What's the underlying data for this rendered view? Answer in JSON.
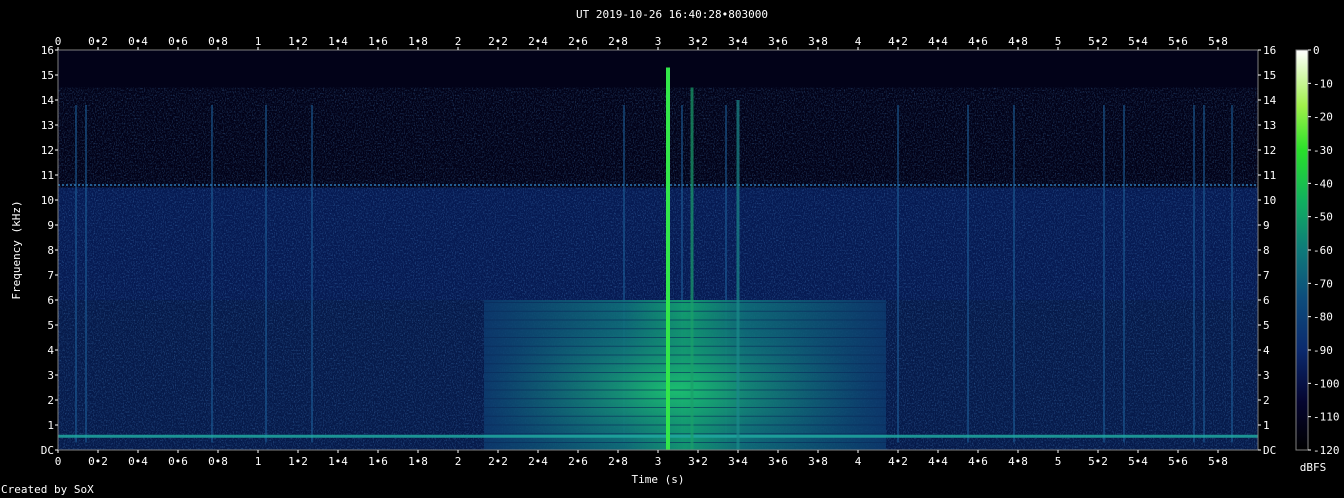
{
  "chart_data": {
    "type": "heatmap",
    "title": "UT 2019-10-26 16:40:28•803000",
    "xlabel": "Time (s)",
    "ylabel": "Frequency (kHz)",
    "xlim": [
      0,
      6
    ],
    "ylim": [
      0,
      16
    ],
    "x_ticks": [
      "0",
      "0•2",
      "0•4",
      "0•6",
      "0•8",
      "1",
      "1•2",
      "1•4",
      "1•6",
      "1•8",
      "2",
      "2•2",
      "2•4",
      "2•6",
      "2•8",
      "3",
      "3•2",
      "3•4",
      "3•6",
      "3•8",
      "4",
      "4•2",
      "4•4",
      "4•6",
      "4•8",
      "5",
      "5•2",
      "5•4",
      "5•6",
      "5•8"
    ],
    "y_ticks": [
      "DC",
      "1",
      "2",
      "3",
      "4",
      "5",
      "6",
      "7",
      "8",
      "9",
      "10",
      "11",
      "12",
      "13",
      "14",
      "15",
      "16"
    ],
    "colorbar": {
      "label": "dBFS",
      "ticks": [
        "0",
        "-10",
        "-20",
        "-30",
        "-40",
        "-50",
        "-60",
        "-70",
        "-80",
        "-90",
        "-100",
        "-110",
        "-120"
      ],
      "range": [
        -120,
        0
      ]
    },
    "features": {
      "background_noise_floor_dbfs": -100,
      "broadband_band_edge_khz": 6,
      "hum_line_khz": 0.55,
      "tone_line_khz": 10.6,
      "burst_block": {
        "t_start_s": 2.13,
        "t_end_s": 4.14,
        "f_max_khz": 6
      },
      "click_peak": {
        "t_s": 3.05,
        "f_max_khz": 15.3,
        "level_dbfs": -45
      }
    }
  },
  "credit": "Created by SoX"
}
